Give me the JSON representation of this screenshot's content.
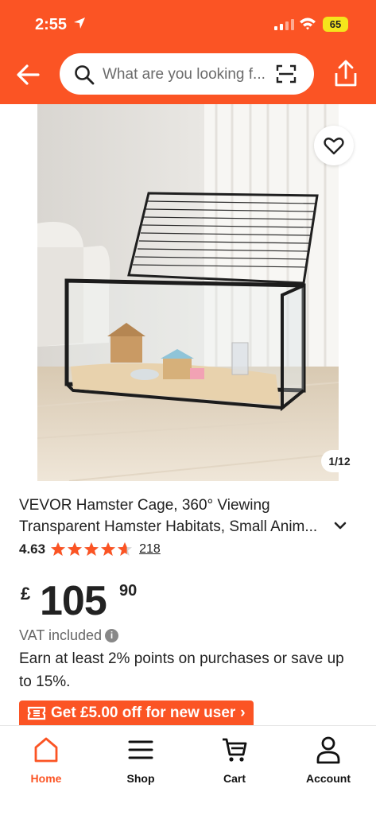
{
  "status_bar": {
    "time": "2:55",
    "battery": "65"
  },
  "header": {
    "search_placeholder": "What are you looking f...",
    "icons": [
      "back-arrow-icon",
      "search-icon",
      "scan-icon",
      "share-icon"
    ]
  },
  "gallery": {
    "counter": "1/12",
    "favorite_icon": "heart-icon"
  },
  "product": {
    "title": "VEVOR Hamster Cage, 360° Viewing Transparent Hamster Habitats, Small Anim...",
    "rating": "4.63",
    "rating_value": 4.63,
    "review_count": "218",
    "price_currency": "£",
    "price_whole": "105",
    "price_fraction": "90",
    "vat_text": "VAT included",
    "points_text": "Earn at least 2% points on purchases or save up to 15%."
  },
  "promo": {
    "label": "Get £5.00 off for new user",
    "chevron": "›"
  },
  "bottom_nav": {
    "items": [
      {
        "label": "Home",
        "icon": "home-icon",
        "active": true
      },
      {
        "label": "Shop",
        "icon": "menu-icon",
        "active": false
      },
      {
        "label": "Cart",
        "icon": "cart-icon",
        "active": false
      },
      {
        "label": "Account",
        "icon": "account-icon",
        "active": false
      }
    ]
  },
  "colors": {
    "brand": "#fb5424",
    "battery": "#f5e51c"
  }
}
